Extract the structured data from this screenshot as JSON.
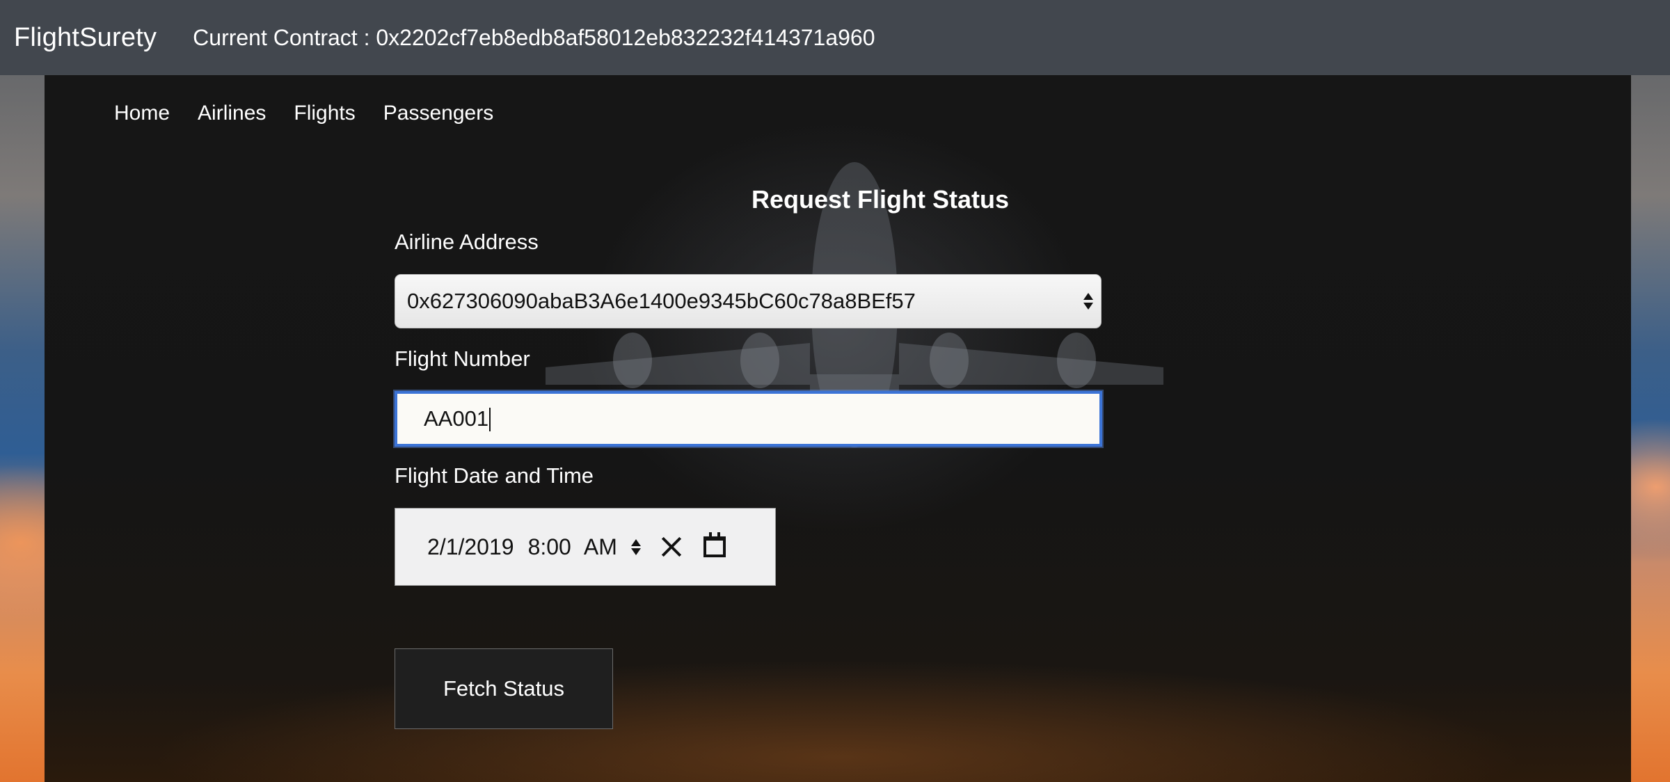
{
  "header": {
    "brand": "FlightSurety",
    "contract_label": "Current Contract : 0x2202cf7eb8edb8af58012eb832232f414371a960"
  },
  "nav": {
    "items": [
      {
        "label": "Home"
      },
      {
        "label": "Airlines"
      },
      {
        "label": "Flights"
      },
      {
        "label": "Passengers"
      }
    ]
  },
  "form": {
    "title": "Request Flight Status",
    "airline_label": "Airline Address",
    "airline_value": "0x627306090abaB3A6e1400e9345bC60c78a8BEf57",
    "flight_number_label": "Flight Number",
    "flight_number_value": "AA001",
    "datetime_label": "Flight Date and Time",
    "datetime_date": "2/1/2019",
    "datetime_time": "8:00",
    "datetime_ampm": "AM",
    "submit_label": "Fetch Status"
  },
  "icons": {
    "select_arrows": "up-down-arrows-icon",
    "clear": "close-icon",
    "calendar": "calendar-icon",
    "spinner": "up-down-spinner-icon"
  },
  "colors": {
    "topbar": "#42474e",
    "focus_ring": "#3b73d6"
  }
}
